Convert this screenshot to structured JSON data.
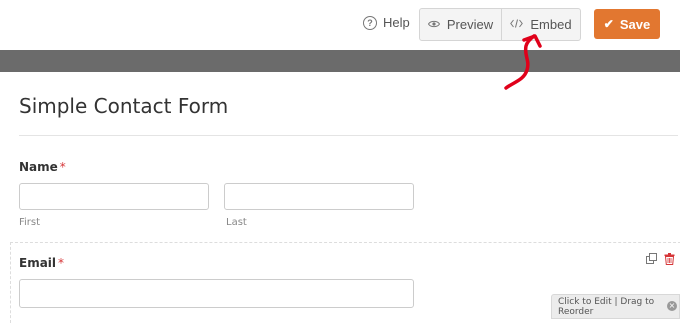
{
  "header": {
    "help_label": "Help",
    "preview_label": "Preview",
    "embed_label": "Embed",
    "save_label": "Save",
    "help_icon": "?",
    "preview_icon": "eye-icon",
    "embed_icon": "code-icon",
    "save_icon": "check-icon"
  },
  "form": {
    "title": "Simple Contact Form",
    "name_field": {
      "label": "Name",
      "required_mark": "*",
      "first_sublabel": "First",
      "last_sublabel": "Last"
    },
    "email_field": {
      "label": "Email",
      "required_mark": "*"
    },
    "reorder_hint": "Click to Edit | Drag to Reorder"
  },
  "colors": {
    "save": "#e27730",
    "required": "#d63638",
    "annotation_arrow": "#e0001a"
  }
}
